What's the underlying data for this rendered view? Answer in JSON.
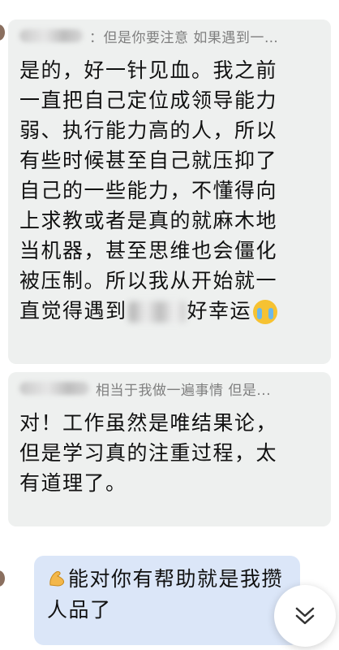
{
  "messages": [
    {
      "quote": "：但是你要注意 如果遇到一…",
      "lines": [
        "是的，好一针见血。我之前",
        "一直把自己定位成领导能力",
        "弱、执行能力高的人，所以",
        "有些时候甚至自己就压抑了",
        "自己的一些能力，不懂得向",
        "上求教或者是真的就麻木地",
        "当机器，甚至思维也会僵化",
        "被压制。所以我从开始就一"
      ],
      "last_line_before": "直觉得遇到",
      "last_line_after": "好幸运",
      "end_emoji": "loudly-crying-face-icon"
    },
    {
      "quote": "相当于我做一遍事情 但是...",
      "lines": [
        "对！工作虽然是唯结果论，",
        "但是学习真的注重过程，太",
        "有道理了。"
      ]
    }
  ],
  "my_message": {
    "emoji": "flexed-biceps-icon",
    "line1": "能对你有帮助就是我攒",
    "line2": "人品了"
  },
  "scroll_button_icon": "double-chevron-down-icon",
  "colors": {
    "card_bg": "#eef0ef",
    "my_bubble_bg": "#dbe6f8",
    "quote_text": "#7f7f7f",
    "body_text": "#111111"
  }
}
